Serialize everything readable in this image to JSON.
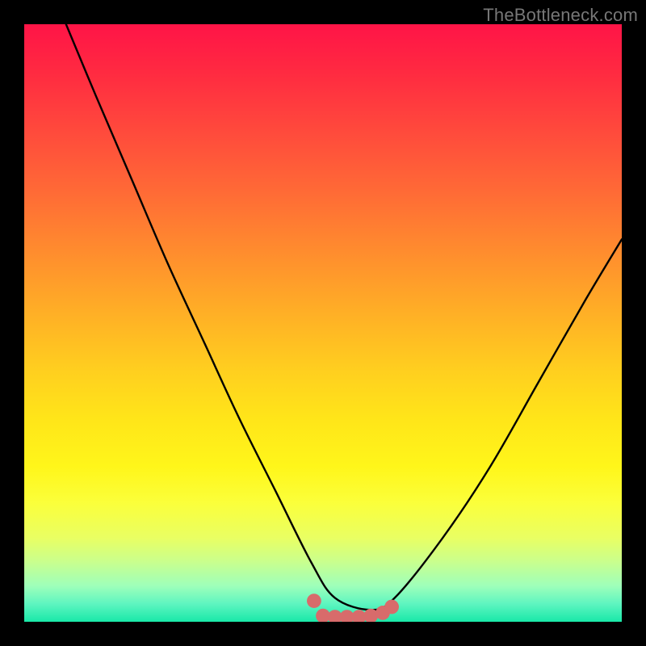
{
  "watermark": "TheBottleneck.com",
  "chart_data": {
    "type": "line",
    "title": "",
    "xlabel": "",
    "ylabel": "",
    "xlim": [
      0,
      1
    ],
    "ylim": [
      0,
      1
    ],
    "background_gradient": {
      "direction": "vertical",
      "stops": [
        {
          "pos": 0.0,
          "color": "#ff1447"
        },
        {
          "pos": 0.5,
          "color": "#ffc31f"
        },
        {
          "pos": 0.8,
          "color": "#fbff3a"
        },
        {
          "pos": 1.0,
          "color": "#19e8a8"
        }
      ]
    },
    "series": [
      {
        "name": "bottleneck-curve",
        "color": "#000000",
        "x": [
          0.07,
          0.12,
          0.18,
          0.24,
          0.3,
          0.36,
          0.42,
          0.48,
          0.52,
          0.58,
          0.62,
          0.7,
          0.78,
          0.86,
          0.94,
          1.0
        ],
        "y": [
          1.0,
          0.88,
          0.74,
          0.6,
          0.47,
          0.34,
          0.22,
          0.1,
          0.04,
          0.02,
          0.04,
          0.14,
          0.26,
          0.4,
          0.54,
          0.64
        ]
      }
    ],
    "markers": {
      "name": "sweet-spot",
      "color": "#d86b6b",
      "points": [
        {
          "x": 0.485,
          "y": 0.035
        },
        {
          "x": 0.5,
          "y": 0.01
        },
        {
          "x": 0.52,
          "y": 0.008
        },
        {
          "x": 0.54,
          "y": 0.008
        },
        {
          "x": 0.56,
          "y": 0.008
        },
        {
          "x": 0.58,
          "y": 0.01
        },
        {
          "x": 0.6,
          "y": 0.015
        },
        {
          "x": 0.615,
          "y": 0.025
        }
      ],
      "radius": 0.012
    }
  }
}
